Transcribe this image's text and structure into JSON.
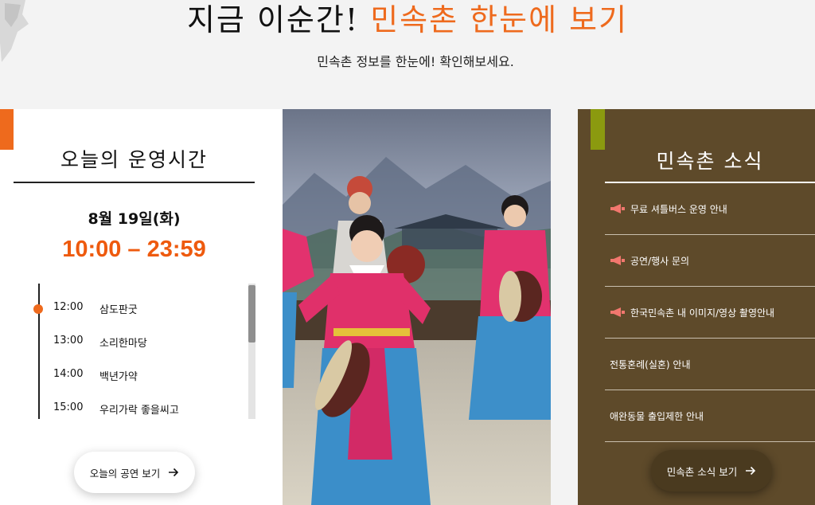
{
  "header": {
    "title_main": "지금 이순간!",
    "title_accent": "민속촌 한눈에 보기",
    "subtitle": "민속촌 정보를 한눈에! 확인해보세요."
  },
  "hours_panel": {
    "title": "오늘의 운영시간",
    "date": "8월 19일(화)",
    "hours": "10:00 – 23:59",
    "schedule": [
      {
        "time": "12:00",
        "name": "삼도판굿"
      },
      {
        "time": "13:00",
        "name": "소리한마당"
      },
      {
        "time": "14:00",
        "name": "백년가약"
      },
      {
        "time": "15:00",
        "name": "우리가락 좋을씨고"
      }
    ],
    "button_label": "오늘의 공연 보기"
  },
  "news_panel": {
    "title": "민속촌 소식",
    "items": [
      {
        "label": "무료 셔틀버스 운영 안내",
        "icon": "megaphone-icon"
      },
      {
        "label": "공연/행사 문의",
        "icon": "megaphone-icon"
      },
      {
        "label": "한국민속촌 내 이미지/영상 촬영안내",
        "icon": "megaphone-icon"
      },
      {
        "label": "전통혼례(실혼) 안내",
        "icon": ""
      },
      {
        "label": "애완동물 출입제한 안내",
        "icon": ""
      }
    ],
    "button_label": "민속촌 소식 보기"
  },
  "colors": {
    "accent": "#ee6a1d",
    "news_bg": "#5e4a2a",
    "news_tag": "#8b9a0f",
    "megaphone": "#f2776e"
  }
}
